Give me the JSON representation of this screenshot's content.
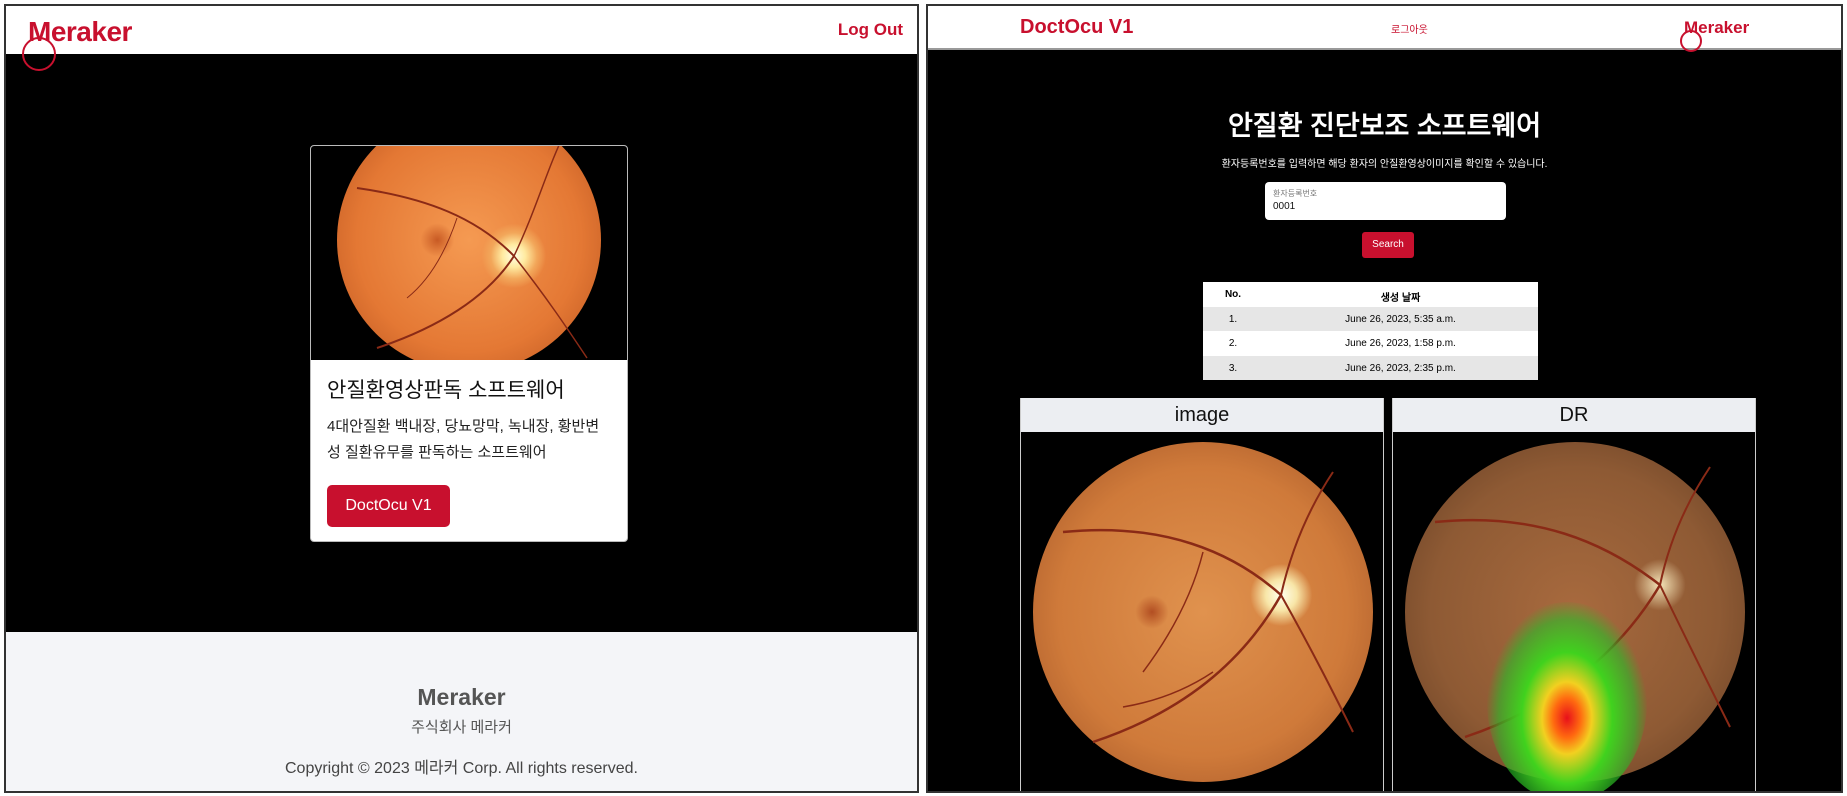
{
  "left": {
    "nav": {
      "brand": "Meraker",
      "logout": "Log Out"
    },
    "card": {
      "title": "안질환영상판독 소프트웨어",
      "description": "4대안질환 백내장, 당뇨망막, 녹내장, 황반변성 질환유무를 판독하는 소프트웨어",
      "button": "DoctOcu V1"
    },
    "footer": {
      "brand": "Meraker",
      "subtitle": "주식회사 메라커",
      "copyright": "Copyright © 2023 메라커 Corp. All rights reserved."
    }
  },
  "right": {
    "nav": {
      "app_name": "DoctOcu V1",
      "logout": "로그아웃",
      "brand": "Meraker"
    },
    "title": "안질환 진단보조 소프트웨어",
    "subtitle": "환자등록번호를 입력하면 해당 환자의 안질환영상이미지를 확인할 수 있습니다.",
    "search": {
      "label": "환자등록번호",
      "value": "0001",
      "button": "Search"
    },
    "table": {
      "headers": [
        "No.",
        "생성 날짜"
      ],
      "rows": [
        {
          "no": "1.",
          "date": "June 26, 2023, 5:35 a.m."
        },
        {
          "no": "2.",
          "date": "June 26, 2023, 1:58 p.m."
        },
        {
          "no": "3.",
          "date": "June 26, 2023, 2:35 p.m."
        }
      ]
    },
    "panels": {
      "image": "image",
      "dr": "DR"
    }
  },
  "colors": {
    "accent": "#c8102e",
    "background": "#000000",
    "footer": "#f4f5f8"
  }
}
